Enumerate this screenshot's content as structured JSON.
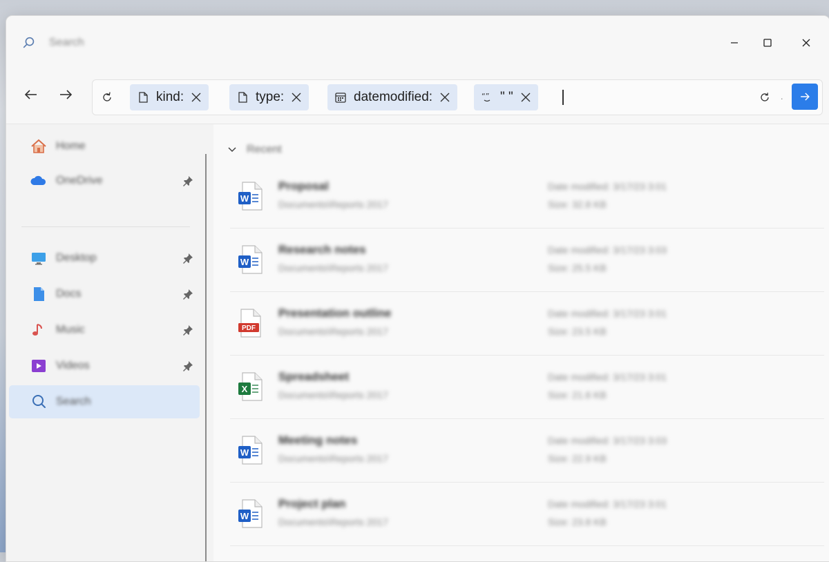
{
  "window": {
    "title": "Search",
    "controls": {
      "minimize": "minimize",
      "maximize": "maximize",
      "close": "close"
    }
  },
  "searchbar": {
    "chips": [
      {
        "label": "kind:",
        "icon": "document-icon"
      },
      {
        "label": "type:",
        "icon": "document-icon"
      },
      {
        "label": "datemodified:",
        "icon": "calendar-icon"
      },
      {
        "label": "\" \"",
        "icon": "quote-icon"
      }
    ],
    "value": ""
  },
  "sidebar": {
    "items": [
      {
        "label": "Home",
        "icon": "home-icon",
        "pinned": false
      },
      {
        "label": "OneDrive",
        "icon": "cloud-icon",
        "pinned": true
      },
      {
        "label": "Desktop",
        "icon": "desktop-icon",
        "pinned": true
      },
      {
        "label": "Docs",
        "icon": "document-icon",
        "pinned": true
      },
      {
        "label": "Music",
        "icon": "music-icon",
        "pinned": true
      },
      {
        "label": "Videos",
        "icon": "video-icon",
        "pinned": true
      },
      {
        "label": "Search",
        "icon": "search-icon",
        "pinned": false,
        "selected": true
      }
    ]
  },
  "main": {
    "group_label": "Recent",
    "files": [
      {
        "name": "Proposal",
        "path": "Documents\\Reports 2017",
        "date": "Date modified: 3/17/23 3:01",
        "size": "Size: 32.8 KB",
        "filetype": "word"
      },
      {
        "name": "Research notes",
        "path": "Documents\\Reports 2017",
        "date": "Date modified: 3/17/23 3:03",
        "size": "Size: 25.5 KB",
        "filetype": "word"
      },
      {
        "name": "Presentation outline",
        "path": "Documents\\Reports 2017",
        "date": "Date modified: 3/17/23 3:01",
        "size": "Size: 23.5 KB",
        "filetype": "pdf"
      },
      {
        "name": "Spreadsheet",
        "path": "Documents\\Reports 2017",
        "date": "Date modified: 3/17/23 3:01",
        "size": "Size: 21.6 KB",
        "filetype": "excel"
      },
      {
        "name": "Meeting notes",
        "path": "Documents\\Reports 2017",
        "date": "Date modified: 3/17/23 3:03",
        "size": "Size: 22.9 KB",
        "filetype": "word"
      },
      {
        "name": "Project plan",
        "path": "Documents\\Reports 2017",
        "date": "Date modified: 3/17/23 3:01",
        "size": "Size: 23.8 KB",
        "filetype": "word"
      }
    ]
  },
  "colors": {
    "accent": "#2b7de9",
    "chip_bg": "#dfe8f6",
    "selected_bg": "#dce8f8",
    "word": "#1f5fc6",
    "excel": "#1d7a3e",
    "pdf": "#d13a2f",
    "home": "#d9704a",
    "cloud": "#2f7ae6",
    "video": "#8b3fd1"
  }
}
